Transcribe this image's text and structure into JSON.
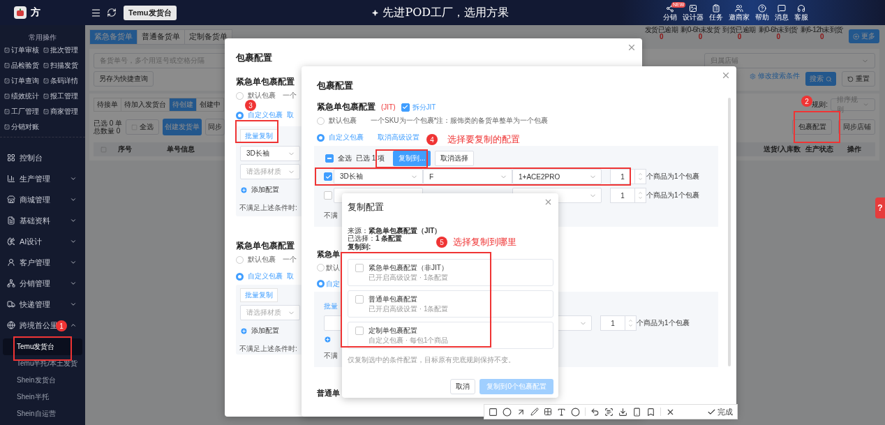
{
  "topbar": {
    "brand": "方",
    "page_tag": "Temu发货台",
    "slogan": "先进POD工厂，选用方果",
    "tools": [
      {
        "label": "分销",
        "badge": "NEW",
        "kind": "share"
      },
      {
        "label": "设计器",
        "kind": "image"
      },
      {
        "label": "任务",
        "kind": "task"
      },
      {
        "label": "邀商家",
        "kind": "users"
      },
      {
        "label": "帮助",
        "kind": "help"
      },
      {
        "label": "消息",
        "kind": "message"
      },
      {
        "label": "客服",
        "kind": "service"
      }
    ]
  },
  "sidebar": {
    "quick_title": "常用操作",
    "quick_links": [
      "订单审核",
      "批次管理",
      "品检验货",
      "扫描发货",
      "订单查询",
      "条码详情",
      "绩效统计",
      "报工管理",
      "工厂管理",
      "商家管理",
      "分销对账"
    ],
    "menu": [
      {
        "label": "控制台",
        "kind": "dashboard"
      },
      {
        "label": "生产管理",
        "kind": "factory",
        "expanded": false
      },
      {
        "label": "商城管理",
        "kind": "shop",
        "expanded": false
      },
      {
        "label": "基础资料",
        "kind": "data",
        "expanded": false
      },
      {
        "label": "AI设计",
        "kind": "ai",
        "expanded": false
      },
      {
        "label": "客户管理",
        "kind": "customer",
        "expanded": false
      },
      {
        "label": "分销管理",
        "kind": "distribution",
        "expanded": false
      },
      {
        "label": "快递管理",
        "kind": "express",
        "expanded": false
      },
      {
        "label": "跨境首公里",
        "kind": "globe",
        "expanded": true,
        "children": [
          {
            "label": "Temu发货台",
            "selected": true
          },
          {
            "label": "Temu半托/本土发货",
            "selected": false
          },
          {
            "label": "Shein发货台",
            "selected": false
          },
          {
            "label": "Shein半托",
            "selected": false
          },
          {
            "label": "Shein自运营",
            "selected": false
          }
        ]
      }
    ]
  },
  "main": {
    "order_tabs": [
      {
        "label": "紧急备货单",
        "selected": true
      },
      {
        "label": "普通备货单",
        "selected": false
      },
      {
        "label": "定制备货单",
        "selected": false
      }
    ],
    "stats": [
      {
        "label": "发货已逾期",
        "value": "0"
      },
      {
        "label": "剩0-6h未发货",
        "value": "0"
      },
      {
        "label": "到货已逾期",
        "value": "0"
      },
      {
        "label": "剩0-6h未到货",
        "value": "0"
      },
      {
        "label": "剩6-12h未到货",
        "value": "0"
      }
    ],
    "more_button": "更多",
    "search_placeholder": "备货单号，多个用逗号或空格分隔",
    "shop_placeholder": "归属店铺",
    "save_query": "另存为快捷查询",
    "edit_search": "修改搜索条件",
    "search_button": "搜索",
    "reset_button": "重置",
    "status_tabs": [
      {
        "label": "待接单",
        "selected": false
      },
      {
        "label": "待加入发货台",
        "selected": false
      },
      {
        "label": "待创建",
        "selected": true
      },
      {
        "label": "创建中",
        "selected": false
      }
    ],
    "sort_label": "规则:",
    "sort_placeholder": "排序规则",
    "selected_count": "已选 0 单",
    "total_count": "总数量 0",
    "select_all": "全选",
    "create_button": "创建发货单",
    "sync_button": "同步",
    "package_button": "包裹配置",
    "sync_shop_button": "同步店铺",
    "columns": [
      "序号",
      "单号信息",
      "送货/入库数",
      "生产状态",
      "操作"
    ],
    "help_tab": "?"
  },
  "modal_back": {
    "title": "包裹配置",
    "sections": [
      {
        "title": "紧急单包裹配置",
        "options": [
          {
            "label": "默认包裹",
            "note": "一个",
            "selected": false
          },
          {
            "label": "自定义包裹",
            "note": "取",
            "selected": true
          }
        ],
        "batch_copy": "批量复制",
        "fields": [
          {
            "value": "3D长袖"
          },
          {
            "placeholder": "请选择材质"
          }
        ],
        "add_config": "添加配置",
        "fallback": "不满足上述条件时:"
      },
      {
        "title": "紧急单包裹配置",
        "options": [
          {
            "label": "默认包裹",
            "note": "一个",
            "selected": false
          },
          {
            "label": "自定义包裹",
            "note": "取",
            "selected": true
          }
        ],
        "batch_copy": "批量复制",
        "fields": [
          {
            "placeholder": "请选择材质"
          }
        ],
        "add_config": "添加配置",
        "fallback": "不满足上述条件时:"
      }
    ]
  },
  "modal_front": {
    "title": "包裹配置",
    "section_title": "紧急单包裹配置",
    "jit_tag": "(JIT)",
    "split_jit": {
      "label": "拆分JIT",
      "checked": true
    },
    "options": [
      {
        "label": "默认包裹",
        "note": "一个SKU为一个包裹*注：服饰类的备货单整单为一个包裹",
        "selected": false
      },
      {
        "label": "自定义包裹",
        "note": "取消高级设置",
        "selected": true
      }
    ],
    "bulk": {
      "select_all": "全选",
      "indeterminate": true,
      "selected_count": "已选 1 项",
      "copy_button": "复制到...",
      "cancel_button": "取消选择"
    },
    "rules": [
      {
        "checked": true,
        "fields": [
          "3D长袖",
          "F",
          "1+ACE2PRO"
        ],
        "quantity": "1",
        "suffix": "个商品为1个包裹"
      },
      {
        "checked": false,
        "quantity": "1",
        "suffix": "个商品为1个包裹"
      }
    ],
    "fallback": "不满",
    "section2": {
      "title": "紧急单",
      "options": [
        {
          "label": "默认",
          "selected": false
        },
        {
          "label": "自定",
          "selected": true
        }
      ],
      "batch_copy": "批量",
      "rules": [
        {
          "quantity": "1",
          "suffix": "个商品为1个包裹"
        }
      ],
      "fallback": "不满"
    },
    "section3_title": "普通单"
  },
  "copy_dialog": {
    "title": "复制配置",
    "source": "来源：**紧急单包裹配置（JIT）**",
    "selection": "已选择：**1 条配置**",
    "copy_to_label": "复制到:",
    "targets": [
      {
        "title": "紧急单包裹配置（非JIT）",
        "detail": "已开启高级设置 · 1条配置",
        "checked": false
      },
      {
        "title": "普通单包裹配置",
        "detail": "已开启高级设置 · 1条配置",
        "checked": false
      },
      {
        "title": "定制单包裹配置",
        "detail": "自定义包裹 · 每包1个商品",
        "checked": false
      }
    ],
    "note": "仅复制选中的条件配置，目标原有兜底规则保持不变。",
    "cancel_button": "取消",
    "confirm_button": {
      "label": "复制到0个包裹配置",
      "disabled": true
    }
  },
  "annotations": [
    {
      "number": "1"
    },
    {
      "number": "2"
    },
    {
      "number": "3"
    },
    {
      "number": "4",
      "caption": "选择要复制的配置"
    },
    {
      "number": "5",
      "caption": "选择复制到哪里"
    }
  ],
  "capture_toolbar": {
    "done_label": "完成"
  }
}
